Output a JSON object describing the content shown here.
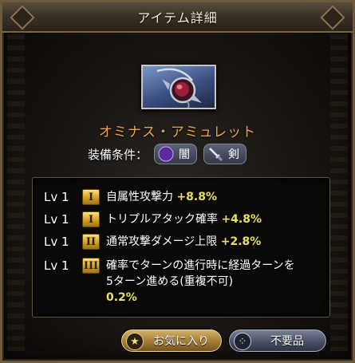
{
  "window": {
    "title": "アイテム詳細"
  },
  "item": {
    "name": "オミナス・アミュレット",
    "icon": "amulet-icon"
  },
  "equip": {
    "label": "装備条件：",
    "conditions": [
      {
        "icon": "dark-element-icon",
        "label": "闇"
      },
      {
        "icon": "sword-icon",
        "label": "剣"
      }
    ]
  },
  "skills": [
    {
      "level": "Lv 1",
      "rank": "I",
      "text": "自属性攻撃力",
      "bonus": "+8.8%"
    },
    {
      "level": "Lv 1",
      "rank": "I",
      "text": "トリプルアタック確率",
      "bonus": "+4.8%"
    },
    {
      "level": "Lv 1",
      "rank": "II",
      "text": "通常攻撃ダメージ上限",
      "bonus": "+2.8%"
    },
    {
      "level": "Lv 1",
      "rank": "III",
      "text": "確率でターンの進行時に経過ターンを5ターン進める(重複不可)",
      "bonus": "0.2%"
    }
  ],
  "buttons": {
    "favorite": "お気に入り",
    "unneeded": "不要品"
  },
  "colors": {
    "item_name": "#f0a43b",
    "bonus": "#e8e060",
    "frame": "#6d5a3c"
  }
}
